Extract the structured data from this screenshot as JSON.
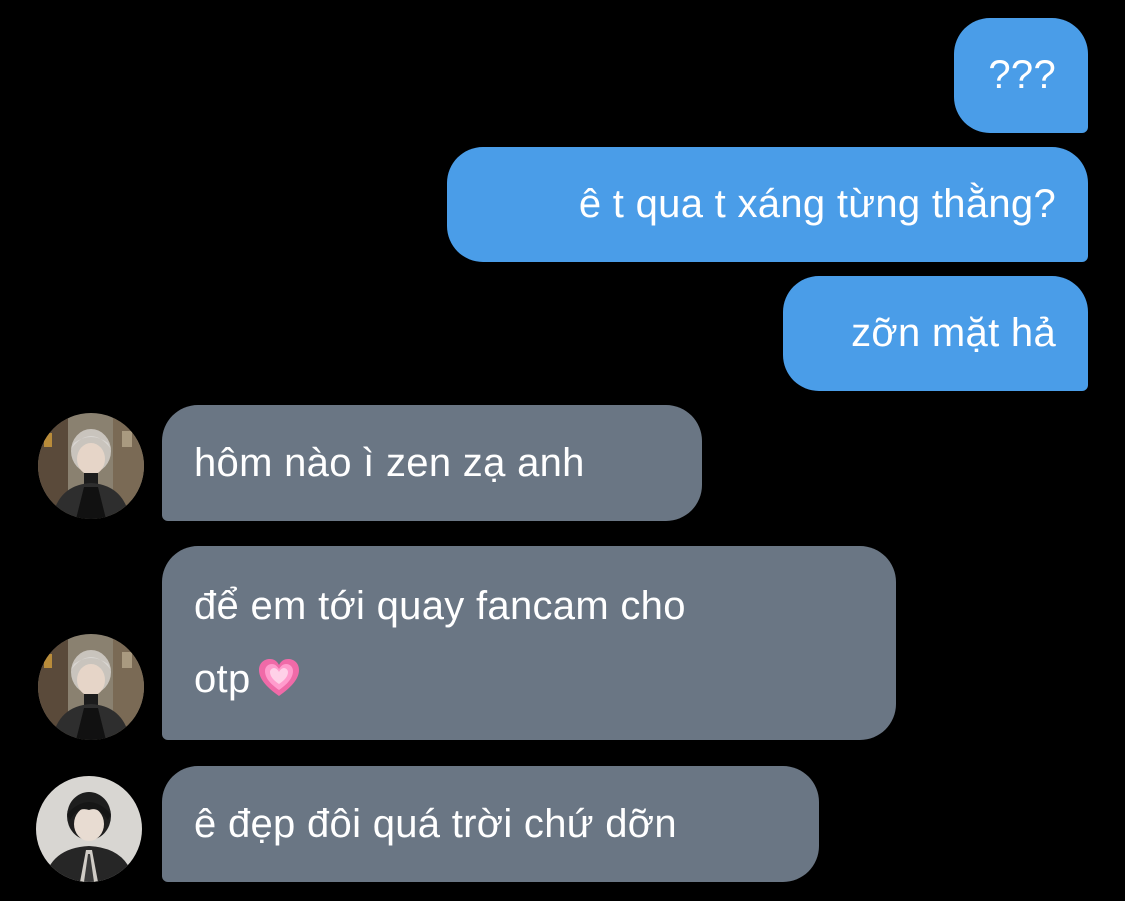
{
  "messages": {
    "out_1": "???",
    "out_2": "ê t qua t xáng từng thằng?",
    "out_3": "zỡn mặt hả",
    "in_1": "hôm nào ì zen zạ anh",
    "in_2_line1": "để em tới quay fancam cho",
    "in_2_line2": "otp",
    "in_3": "ê đẹp đôi quá trời chứ dỡn"
  },
  "icons": {
    "heart": "growing-heart-emoji",
    "avatar_a": "avatar-gray-haired-user",
    "avatar_b": "avatar-dark-haired-user"
  },
  "colors": {
    "background": "#000000",
    "outgoing_bubble": "#4a9de8",
    "incoming_bubble": "#6a7684",
    "text": "#ffffff"
  }
}
